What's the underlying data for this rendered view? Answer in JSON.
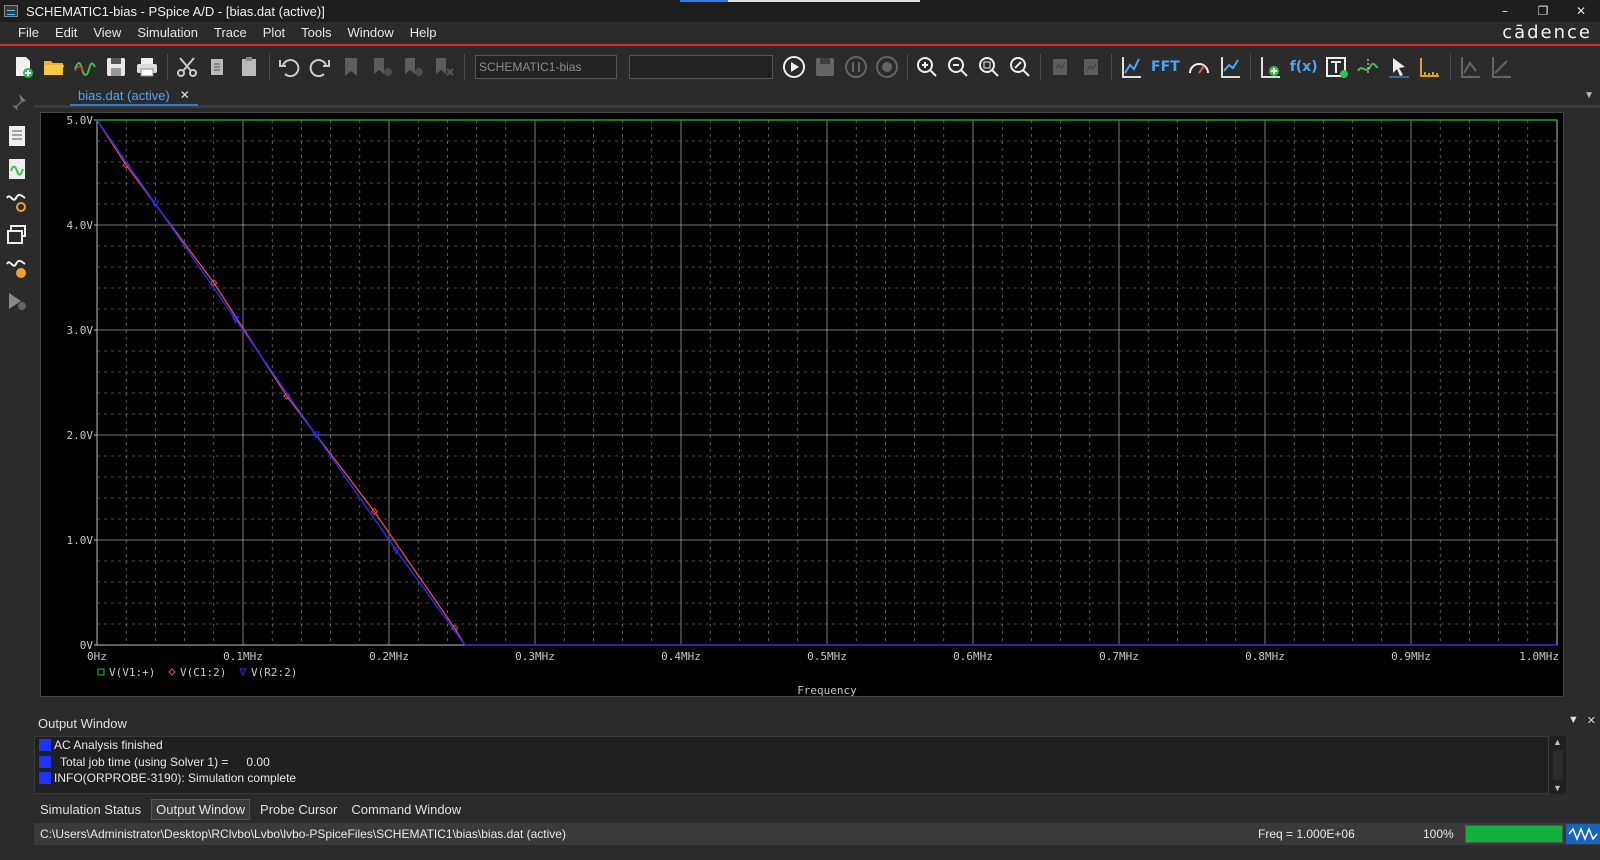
{
  "window": {
    "title": "SCHEMATIC1-bias - PSpice A/D  - [bias.dat (active)]",
    "controls": [
      "–",
      "❐",
      "✕"
    ]
  },
  "menu": {
    "items": [
      "File",
      "Edit",
      "View",
      "Simulation",
      "Trace",
      "Plot",
      "Tools",
      "Window",
      "Help"
    ],
    "brand": "cādence"
  },
  "toolbar": {
    "profile_field": "SCHEMATIC1-bias",
    "sim_field": "",
    "fft_label": "FFT",
    "fx_label": "f(x)"
  },
  "tab": {
    "label": "bias.dat (active)",
    "close": "✕"
  },
  "chart_data": {
    "type": "line",
    "xlabel": "Frequency",
    "ylabel": "",
    "xlim": [
      0,
      1000000
    ],
    "ylim": [
      0,
      5
    ],
    "x_ticks": [
      "0Hz",
      "0.1MHz",
      "0.2MHz",
      "0.3MHz",
      "0.4MHz",
      "0.5MHz",
      "0.6MHz",
      "0.7MHz",
      "0.8MHz",
      "0.9MHz",
      "1.0MHz"
    ],
    "y_ticks": [
      "0V",
      "1.0V",
      "2.0V",
      "3.0V",
      "4.0V",
      "5.0V"
    ],
    "grid": true,
    "legend_position": "bottom-left",
    "series": [
      {
        "name": "V(V1:+)",
        "color": "#22c322",
        "marker": "square",
        "x": [
          0,
          1000000
        ],
        "y": [
          5.0,
          5.0
        ]
      },
      {
        "name": "V(C1:2)",
        "color": "#e05050",
        "marker": "diamond",
        "x": [
          0,
          20000,
          80000,
          130000,
          190000,
          245000,
          252000,
          1000000
        ],
        "y": [
          5.0,
          4.57,
          3.45,
          2.37,
          1.27,
          0.16,
          0,
          0
        ]
      },
      {
        "name": "V(R2:2)",
        "color": "#2a2aff",
        "marker": "triangle",
        "x": [
          0,
          40000,
          95000,
          150000,
          205000,
          252000,
          1000000
        ],
        "y": [
          5.0,
          4.2,
          3.1,
          2.0,
          0.9,
          0,
          0
        ]
      }
    ]
  },
  "output": {
    "title": "Output Window",
    "lines": [
      {
        "text": "AC Analysis finished",
        "value": ""
      },
      {
        "text": "Total job time (using Solver 1)   =",
        "value": "0.00"
      },
      {
        "text": "INFO(ORPROBE-3190): Simulation complete",
        "value": ""
      }
    ]
  },
  "bottom_tabs": [
    "Simulation Status",
    "Output Window",
    "Probe Cursor",
    "Command Window"
  ],
  "status": {
    "path": "C:\\Users\\Administrator\\Desktop\\RClvbo\\Lvbo\\lvbo-PSpiceFiles\\SCHEMATIC1\\bias\\bias.dat (active)",
    "freq": "Freq =  1.000E+06",
    "zoom": "100%",
    "progress": 1.0
  },
  "colors": {
    "grid": "#d0d0d0",
    "accent": "#4fa3f7",
    "menu_line": "#d32f2f"
  }
}
